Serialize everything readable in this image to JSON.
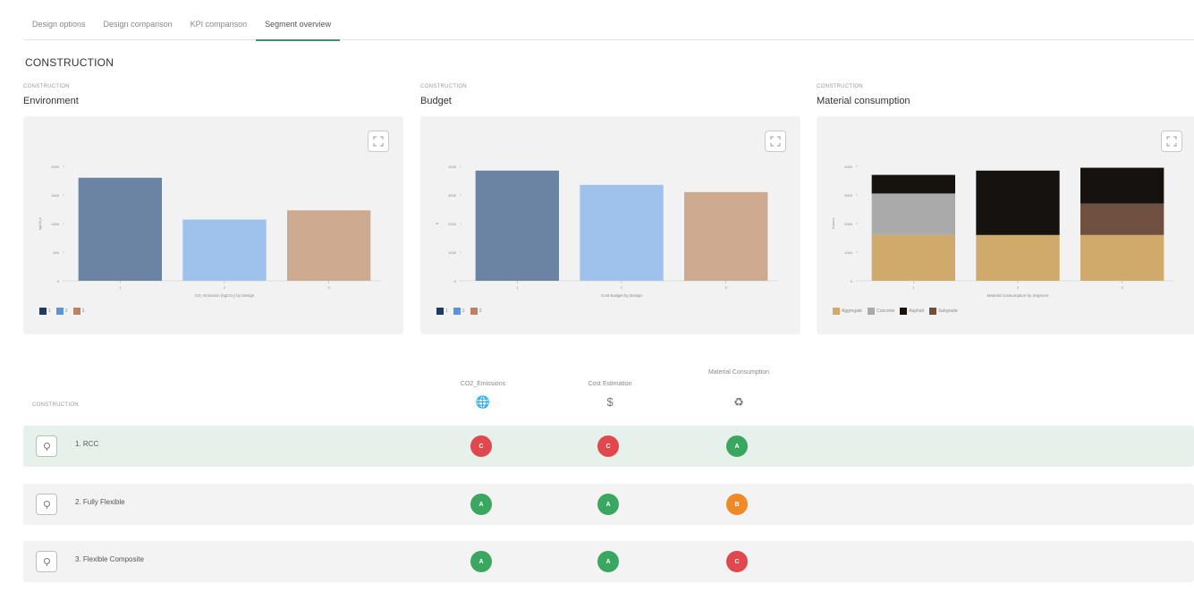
{
  "tabs": [
    {
      "label": "Design options",
      "active": false
    },
    {
      "label": "Design comparison",
      "active": false
    },
    {
      "label": "KPI comparison",
      "active": false
    },
    {
      "label": "Segment overview",
      "active": true
    }
  ],
  "section_title": "CONSTRUCTION",
  "charts": [
    {
      "kicker": "CONSTRUCTION",
      "title": "Environment",
      "expand_icon": "expand-icon"
    },
    {
      "kicker": "CONSTRUCTION",
      "title": "Budget",
      "expand_icon": "expand-icon"
    },
    {
      "kicker": "CONSTRUCTION",
      "title": "Material consumption",
      "expand_icon": "expand-icon"
    }
  ],
  "chart_data": [
    {
      "type": "bar",
      "categories": [
        "1",
        "2",
        "3"
      ],
      "values": [
        1800,
        1070,
        1230
      ],
      "ylim": [
        0,
        2000
      ],
      "yticks": [
        "0",
        "500",
        "1000",
        "1500",
        "2000"
      ],
      "xlabel": "CO₂ Emission (kgCO₂) by Design",
      "ylabel": "kgCO₂e",
      "colors": [
        "#6b84a3",
        "#9fc2ec",
        "#cca98f"
      ],
      "legend_colors": [
        "#1f3b63",
        "#5b95d6",
        "#b98466"
      ],
      "legend": [
        "1",
        "2",
        "3"
      ],
      "legend_placement": "bottom-left",
      "grid": false
    },
    {
      "type": "bar",
      "categories": [
        "1",
        "2",
        "3"
      ],
      "values": [
        3850,
        3350,
        3100
      ],
      "ylim": [
        0,
        4000
      ],
      "yticks": [
        "0",
        "1000",
        "2000",
        "3000",
        "4000"
      ],
      "xlabel": "Cost Budget by Design",
      "ylabel": "$",
      "colors": [
        "#6b84a3",
        "#9fc2ec",
        "#cca98f"
      ],
      "legend_colors": [
        "#1f3b63",
        "#5b95d6",
        "#b98466"
      ],
      "legend": [
        "1",
        "2",
        "3"
      ],
      "legend_placement": "bottom-left",
      "grid": false
    },
    {
      "type": "bar",
      "stacked": true,
      "categories": [
        "1",
        "2",
        "3"
      ],
      "series": [
        {
          "name": "Aggregate",
          "color": "#cfaa6b",
          "values": [
            1600,
            1600,
            1600
          ]
        },
        {
          "name": "Concrete",
          "color": "#aaaaaa",
          "values": [
            1450,
            0,
            0
          ]
        },
        {
          "name": "Asphalt",
          "color": "#151210",
          "values": [
            650,
            2250,
            0
          ]
        },
        {
          "name": "Subgrade",
          "color": "#6e4f40",
          "values": [
            0,
            0,
            1100
          ]
        },
        {
          "name": "Asphalt",
          "color": "#151210",
          "values": [
            0,
            0,
            1250
          ]
        }
      ],
      "ylim": [
        0,
        4000
      ],
      "yticks": [
        "0",
        "1000",
        "2000",
        "3000",
        "4000"
      ],
      "xlabel": "Material Consumption by Segment",
      "ylabel": "Tonnes",
      "legend": [
        "Aggregate",
        "Concrete",
        "Asphalt",
        "Subgrade"
      ],
      "legend_colors": [
        "#cfaa6b",
        "#aaaaaa",
        "#151210",
        "#6e4f40"
      ],
      "legend_placement": "bottom-left",
      "grid": false
    }
  ],
  "table": {
    "header_label": "CONSTRUCTION",
    "columns": [
      {
        "label": "CO2_Emissions",
        "icon": "globe-icon",
        "glyph": "🌐"
      },
      {
        "label": "Cost Estimation",
        "icon": "dollar-icon",
        "glyph": "$"
      },
      {
        "label": "Material Consumption",
        "icon": "recycle-icon",
        "glyph": "♻"
      }
    ],
    "rows": [
      {
        "label": "1. RCC",
        "highlight": true,
        "grades": [
          {
            "letter": "C",
            "color": "#e0484d"
          },
          {
            "letter": "C",
            "color": "#e0484d"
          },
          {
            "letter": "A",
            "color": "#3aa760"
          }
        ]
      },
      {
        "label": "2. Fully Flexible",
        "highlight": false,
        "grades": [
          {
            "letter": "A",
            "color": "#3aa760"
          },
          {
            "letter": "A",
            "color": "#3aa760"
          },
          {
            "letter": "B",
            "color": "#f0892a"
          }
        ]
      },
      {
        "label": "3. Flexible Composite",
        "highlight": false,
        "grades": [
          {
            "letter": "A",
            "color": "#3aa760"
          },
          {
            "letter": "A",
            "color": "#3aa760"
          },
          {
            "letter": "C",
            "color": "#e0484d"
          }
        ]
      }
    ]
  }
}
